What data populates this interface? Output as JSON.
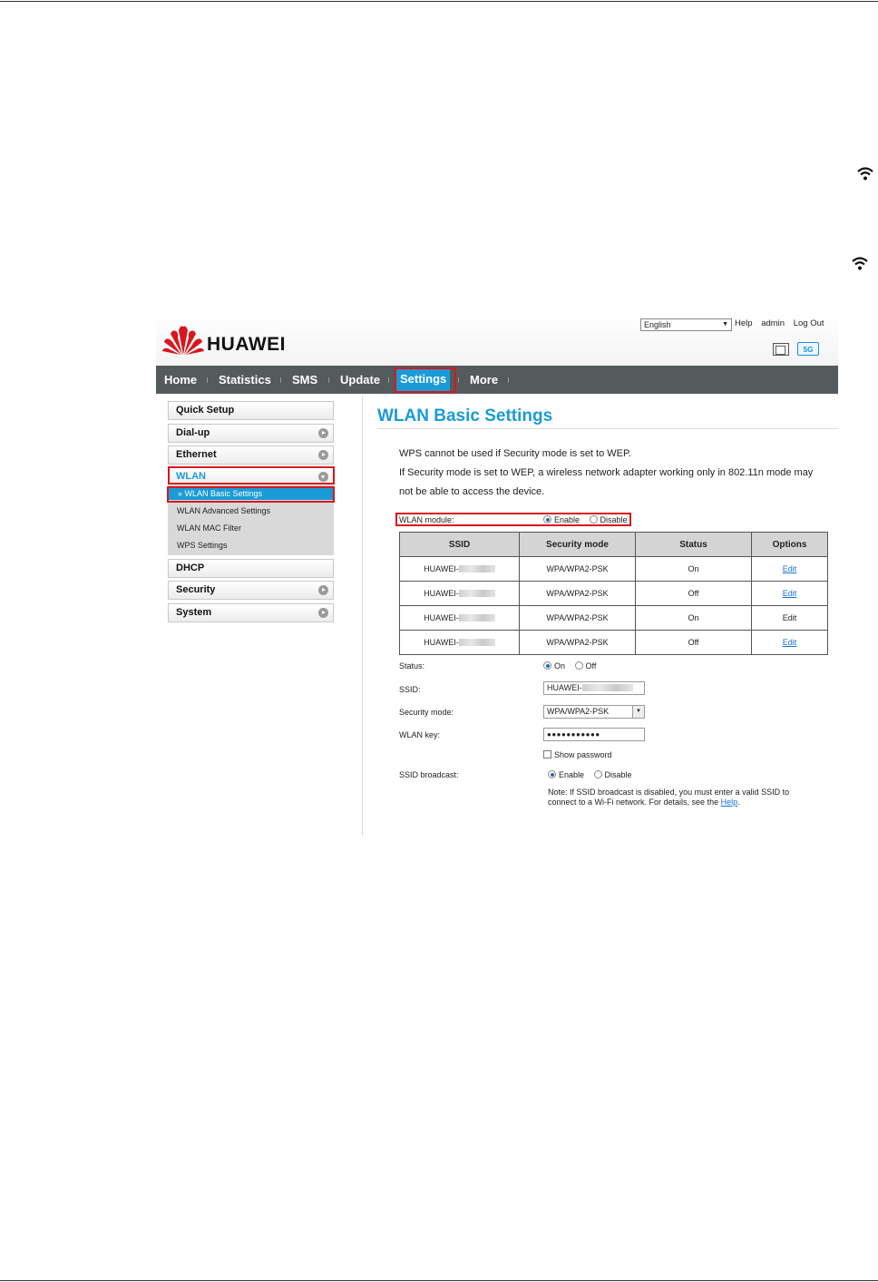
{
  "language": {
    "selected": "English"
  },
  "top_links": {
    "help": "Help",
    "user": "admin",
    "logout": "Log Out"
  },
  "brand": {
    "name": "HUAWEI"
  },
  "status_icons": {
    "band": "5G"
  },
  "nav": [
    {
      "label": "Home"
    },
    {
      "label": "Statistics"
    },
    {
      "label": "SMS"
    },
    {
      "label": "Update"
    },
    {
      "label": "Settings",
      "active": true
    },
    {
      "label": "More"
    }
  ],
  "sidebar": {
    "items": [
      {
        "label": "Quick Setup"
      },
      {
        "label": "Dial-up"
      },
      {
        "label": "Ethernet"
      },
      {
        "label": "WLAN"
      },
      {
        "label": "DHCP"
      },
      {
        "label": "Security"
      },
      {
        "label": "System"
      }
    ],
    "wlan_sub": [
      {
        "label": "WLAN Basic Settings",
        "selected": true
      },
      {
        "label": "WLAN Advanced Settings"
      },
      {
        "label": "WLAN MAC Filter"
      },
      {
        "label": "WPS Settings"
      }
    ]
  },
  "page": {
    "title": "WLAN Basic Settings",
    "info1": "WPS cannot be used if Security mode is set to WEP.",
    "info2a": "If Security mode is set to WEP, a wireless network adapter working only in 802.11n mode may",
    "info2b": "not be able to access the device.",
    "wlan_module": {
      "label": "WLAN module:",
      "enable": "Enable",
      "disable": "Disable",
      "value": "Enable"
    }
  },
  "ssid_table": {
    "headers": [
      "SSID",
      "Security mode",
      "Status",
      "Options"
    ],
    "rows": [
      {
        "ssid": "HUAWEI-",
        "security": "WPA/WPA2-PSK",
        "status": "On",
        "option": "Edit",
        "link": true
      },
      {
        "ssid": "HUAWEI-",
        "security": "WPA/WPA2-PSK",
        "status": "Off",
        "option": "Edit",
        "link": true
      },
      {
        "ssid": "HUAWEI-",
        "security": "WPA/WPA2-PSK",
        "status": "On",
        "option": "Edit",
        "link": false
      },
      {
        "ssid": "HUAWEI-",
        "security": "WPA/WPA2-PSK",
        "status": "Off",
        "option": "Edit",
        "link": true
      }
    ]
  },
  "form": {
    "status_label": "Status:",
    "status_on": "On",
    "status_off": "Off",
    "ssid_label": "SSID:",
    "ssid_value": "HUAWEI-",
    "security_label": "Security mode:",
    "security_value": "WPA/WPA2-PSK",
    "key_label": "WLAN key:",
    "key_value": "●●●●●●●●●●●",
    "show_password": "Show password",
    "broadcast_label": "SSID broadcast:",
    "broadcast_enable": "Enable",
    "broadcast_disable": "Disable",
    "note_a": "Note: If SSID broadcast is disabled, you must enter a valid SSID to connect to a Wi-Fi network. For details, see the",
    "note_link": "Help",
    "note_end": "."
  },
  "colors": {
    "accent": "#1a9bd7",
    "nav_bg": "#555a5c",
    "highlight": "#d7171f"
  }
}
